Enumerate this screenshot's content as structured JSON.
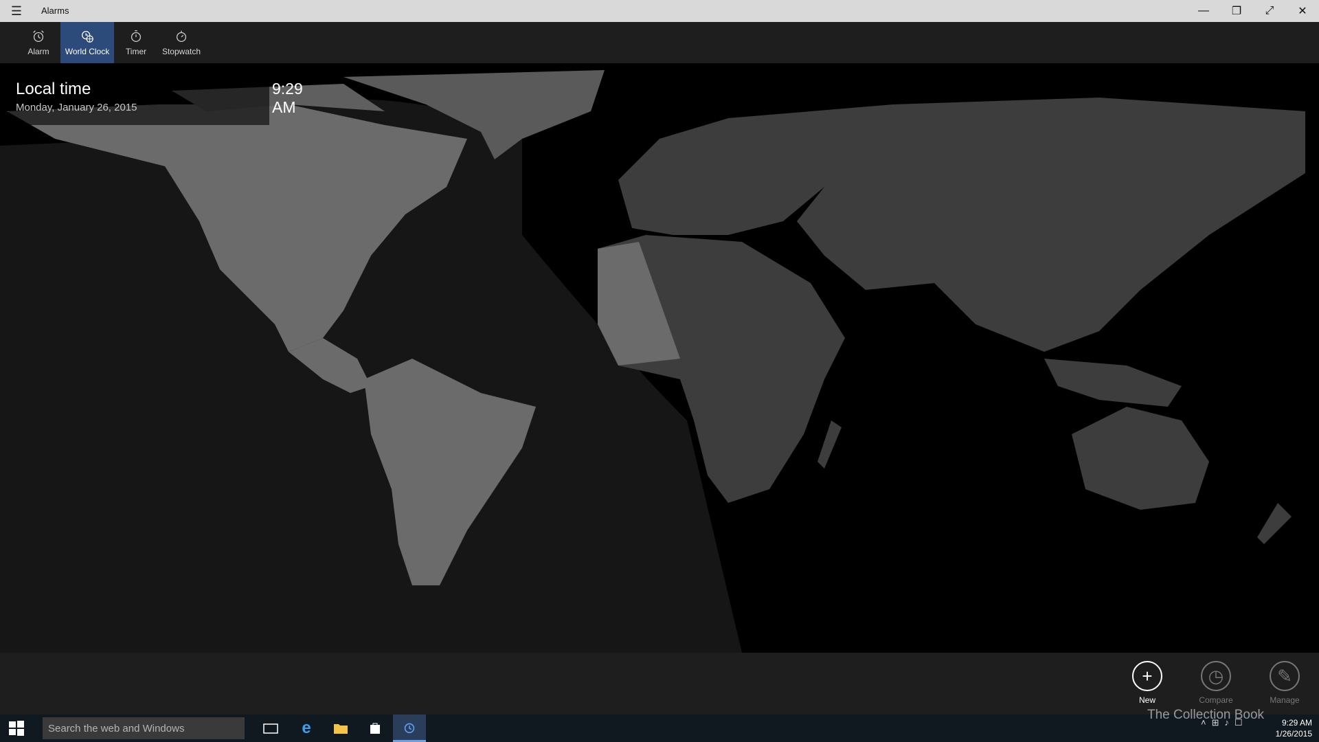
{
  "window": {
    "title": "Alarms",
    "menu_icon": "hamburger-icon",
    "controls": {
      "minimize": "—",
      "restore": "❐",
      "fullscreen": "⤢",
      "close": "✕"
    }
  },
  "tabs": [
    {
      "label": "Alarm",
      "icon": "alarm-clock-icon",
      "active": false
    },
    {
      "label": "World Clock",
      "icon": "world-clock-icon",
      "active": true
    },
    {
      "label": "Timer",
      "icon": "timer-icon",
      "active": false
    },
    {
      "label": "Stopwatch",
      "icon": "stopwatch-icon",
      "active": false
    }
  ],
  "local_time": {
    "label": "Local time",
    "date": "Monday, January 26, 2015",
    "time": "9:29 AM"
  },
  "actions": {
    "new_label": "New",
    "compare_label": "Compare",
    "manage_label": "Manage"
  },
  "taskbar": {
    "search_placeholder": "Search the web and Windows",
    "clock_time": "9:29 AM",
    "clock_date": "1/26/2015"
  },
  "watermark": "The Collection Book",
  "colors": {
    "accent": "#2c4a7a",
    "land_day": "#6b6b6b",
    "land_night": "#3a3a3a",
    "background": "#000000"
  }
}
